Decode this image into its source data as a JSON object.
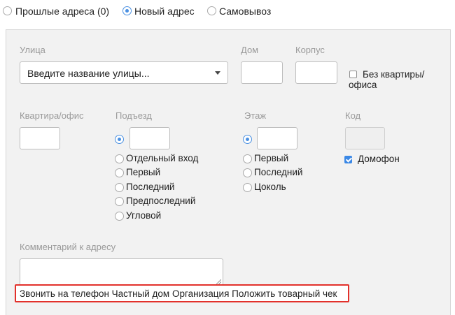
{
  "delivery_options": [
    {
      "label": "Прошлые адреса (0)",
      "selected": false
    },
    {
      "label": "Новый адрес",
      "selected": true
    },
    {
      "label": "Самовывоз",
      "selected": false
    }
  ],
  "form": {
    "street": {
      "label": "Улица",
      "value": "Введите название улицы..."
    },
    "house": {
      "label": "Дом",
      "value": ""
    },
    "building": {
      "label": "Корпус",
      "value": ""
    },
    "no_apartment": {
      "label": "Без квартиры/ офиса",
      "checked": false
    },
    "apartment": {
      "label": "Квартира/офис",
      "value": ""
    },
    "entrance": {
      "label": "Подъезд",
      "value": "",
      "options": [
        "Отдельный вход",
        "Первый",
        "Последний",
        "Предпоследний",
        "Угловой"
      ]
    },
    "floor": {
      "label": "Этаж",
      "value": "",
      "options": [
        "Первый",
        "Последний",
        "Цоколь"
      ]
    },
    "code": {
      "label": "Код",
      "value": ""
    },
    "intercom": {
      "label": "Домофон",
      "checked": true
    },
    "comment": {
      "label": "Комментарий к адресу",
      "value": ""
    },
    "extra_line": "Звонить на телефон Частный дом Организация Положить товарный чек"
  },
  "colors": {
    "accent": "#4a90e2",
    "highlight_border": "#e2302b",
    "panel_bg": "#f2f2f2"
  }
}
